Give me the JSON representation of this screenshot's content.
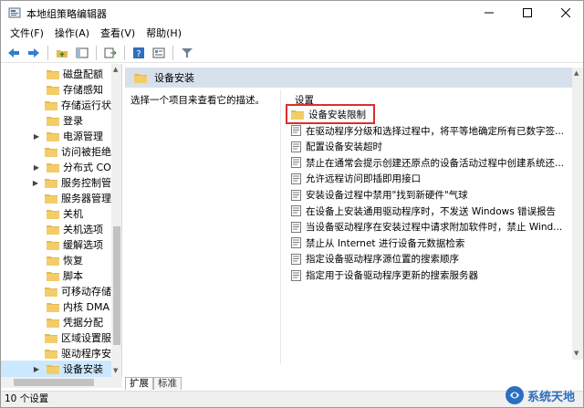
{
  "window": {
    "title": "本地组策略编辑器"
  },
  "menu": [
    "文件(F)",
    "操作(A)",
    "查看(V)",
    "帮助(H)"
  ],
  "tree": {
    "items": [
      {
        "label": "磁盘配额",
        "expandable": false
      },
      {
        "label": "存储感知",
        "expandable": false
      },
      {
        "label": "存储运行状",
        "expandable": false
      },
      {
        "label": "登录",
        "expandable": false
      },
      {
        "label": "电源管理",
        "expandable": true
      },
      {
        "label": "访问被拒绝",
        "expandable": false
      },
      {
        "label": "分布式 CO",
        "expandable": true
      },
      {
        "label": "服务控制管",
        "expandable": true
      },
      {
        "label": "服务器管理",
        "expandable": false
      },
      {
        "label": "关机",
        "expandable": false
      },
      {
        "label": "关机选项",
        "expandable": false
      },
      {
        "label": "缓解选项",
        "expandable": false
      },
      {
        "label": "恢复",
        "expandable": false
      },
      {
        "label": "脚本",
        "expandable": false
      },
      {
        "label": "可移动存储",
        "expandable": false
      },
      {
        "label": "内核 DMA",
        "expandable": false
      },
      {
        "label": "凭据分配",
        "expandable": false
      },
      {
        "label": "区域设置服",
        "expandable": false
      },
      {
        "label": "驱动程序安",
        "expandable": false
      },
      {
        "label": "设备安装",
        "expandable": true,
        "selected": true
      }
    ]
  },
  "right": {
    "header_title": "设备安装",
    "description": "选择一个项目来查看它的描述。",
    "column_header": "设置",
    "settings": [
      {
        "label": "设备安装限制",
        "kind": "folder"
      },
      {
        "label": "在驱动程序分级和选择过程中，将平等地确定所有已数字签...",
        "kind": "policy"
      },
      {
        "label": "配置设备安装超时",
        "kind": "policy"
      },
      {
        "label": "禁止在通常会提示创建还原点的设备活动过程中创建系统还...",
        "kind": "policy"
      },
      {
        "label": "允许远程访问即插即用接口",
        "kind": "policy"
      },
      {
        "label": "安装设备过程中禁用\"找到新硬件\"气球",
        "kind": "policy"
      },
      {
        "label": "在设备上安装通用驱动程序时，不发送 Windows 错误报告",
        "kind": "policy"
      },
      {
        "label": "当设备驱动程序在安装过程中请求附加软件时，禁止 Wind...",
        "kind": "policy"
      },
      {
        "label": "禁止从 Internet 进行设备元数据检索",
        "kind": "policy"
      },
      {
        "label": "指定设备驱动程序源位置的搜索顺序",
        "kind": "policy"
      },
      {
        "label": "指定用于设备驱动程序更新的搜索服务器",
        "kind": "policy"
      }
    ]
  },
  "tabs": [
    "扩展",
    "标准"
  ],
  "status": "10 个设置",
  "watermark": "系统天地",
  "colors": {
    "selected": "#cce8ff",
    "header": "#d7e1ec",
    "highlight": "#d9302c",
    "folder": "#e8b850"
  }
}
